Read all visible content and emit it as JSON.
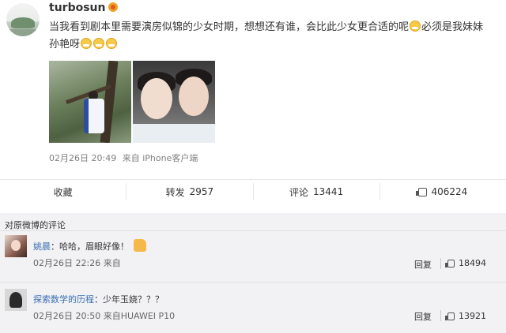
{
  "post": {
    "username": "turbosun",
    "text_part1": "当我看到剧本里需要演房似锦的少女时期，想想还有谁，会比此少女更合适的呢",
    "text_part2": "必须是我妹妹孙艳呀",
    "date": "02月26日 20:49",
    "source": "来自 iPhone客户端"
  },
  "actions": [
    {
      "label": "收藏",
      "count": ""
    },
    {
      "label": "转发",
      "count": "2957"
    },
    {
      "label": "评论",
      "count": "13441"
    },
    {
      "label": "",
      "count": "406224",
      "icon": "thumb-up-icon"
    }
  ],
  "comments_title": "对原微博的评论",
  "comments": [
    {
      "name": "姚晨",
      "text": "：哈哈，眉眼好像！",
      "date": "02月26日 22:26",
      "source": "来自",
      "reply": "回复",
      "likes": "18494"
    },
    {
      "name": "探索数学的历程",
      "text": "：少年玉娆？？？",
      "date": "02月26日 20:50",
      "source": "来自HUAWEI P10",
      "reply": "回复",
      "likes": "13921"
    }
  ],
  "colors": {
    "link": "#3a6fb0",
    "meta": "#808080",
    "comment_bg": "#f2f2f5"
  }
}
